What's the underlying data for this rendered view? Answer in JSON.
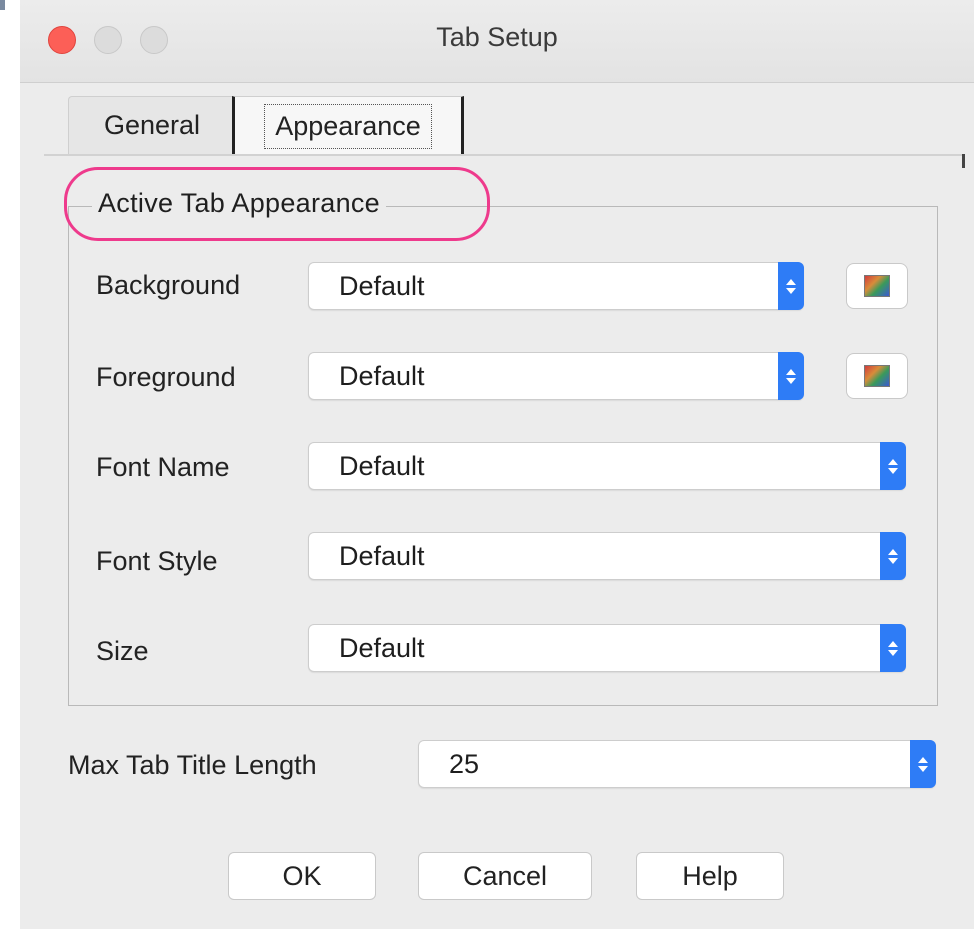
{
  "window": {
    "title": "Tab Setup"
  },
  "tabs": [
    {
      "label": "General",
      "selected": false
    },
    {
      "label": "Appearance",
      "selected": true
    }
  ],
  "group": {
    "title": "Active Tab Appearance"
  },
  "rows": [
    {
      "label": "Background",
      "value": "Default",
      "has_color_button": true
    },
    {
      "label": "Foreground",
      "value": "Default",
      "has_color_button": true
    },
    {
      "label": "Font Name",
      "value": "Default",
      "has_color_button": false
    },
    {
      "label": "Font Style",
      "value": "Default",
      "has_color_button": false
    },
    {
      "label": "Size",
      "value": "Default",
      "has_color_button": false
    }
  ],
  "max_title": {
    "label": "Max Tab Title Length",
    "value": "25"
  },
  "buttons": {
    "ok": "OK",
    "cancel": "Cancel",
    "help": "Help"
  },
  "colors": {
    "close": "#fc5f57",
    "select_arrow": "#2e7cf6",
    "highlight": "#ee3a8c"
  },
  "icons": [
    "color-chooser-icon",
    "up-down-arrows-icon"
  ]
}
